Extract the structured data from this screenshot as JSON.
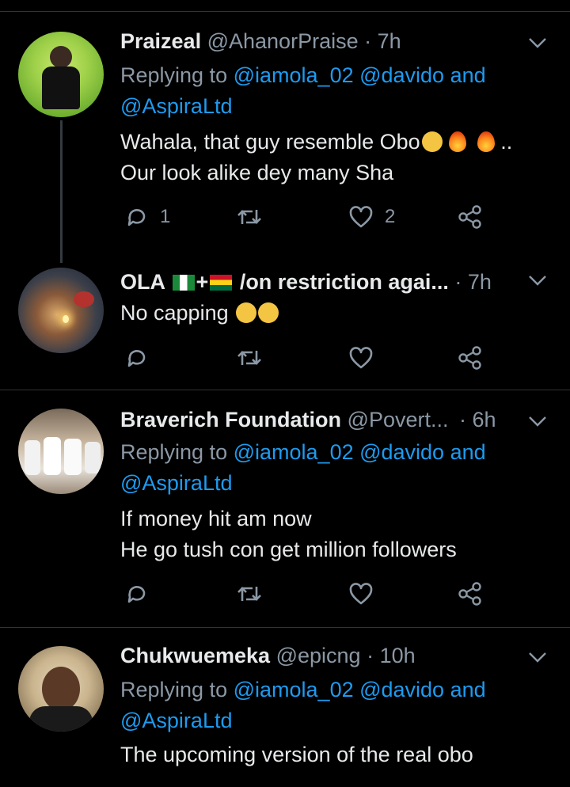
{
  "tweets": [
    {
      "name": "Praizeal",
      "handle": "@AhanorPraise",
      "time": "7h",
      "replying_prefix": "Replying to",
      "replying_links_line1": "@iamola_02 @davido and",
      "replying_links_line2": "@AspiraLtd",
      "text_line1": "Wahala, that guy resemble Obo",
      "text_line1_suffix": " ..",
      "text_line2": "Our look alike dey many Sha",
      "reply_count": "1",
      "like_count": "2"
    },
    {
      "name": "OLA",
      "name_suffix": "/on restriction agai...",
      "plus": "+",
      "time": "7h",
      "text": "No capping"
    },
    {
      "name": "Braverich Foundation",
      "handle": "@Povert...",
      "time": "6h",
      "replying_prefix": "Replying to",
      "replying_links_line1": "@iamola_02 @davido and",
      "replying_links_line2": "@AspiraLtd",
      "text_line1": "If money hit am now",
      "text_line2": "He go tush con get million followers"
    },
    {
      "name": "Chukwuemeka",
      "handle": "@epicng",
      "time": "10h",
      "replying_prefix": "Replying to",
      "replying_links_line1": "@iamola_02 @davido and",
      "replying_links_line2": "@AspiraLtd",
      "text_line1": "The upcoming version of the real obo"
    }
  ],
  "separator": "·",
  "colors": {
    "background": "#000000",
    "text": "#e7e9ea",
    "muted": "#8b98a5",
    "link": "#1d9bf0",
    "divider": "#2f3336"
  },
  "icons": [
    "reply-icon",
    "retweet-icon",
    "like-icon",
    "share-icon",
    "chevron-down-icon"
  ]
}
